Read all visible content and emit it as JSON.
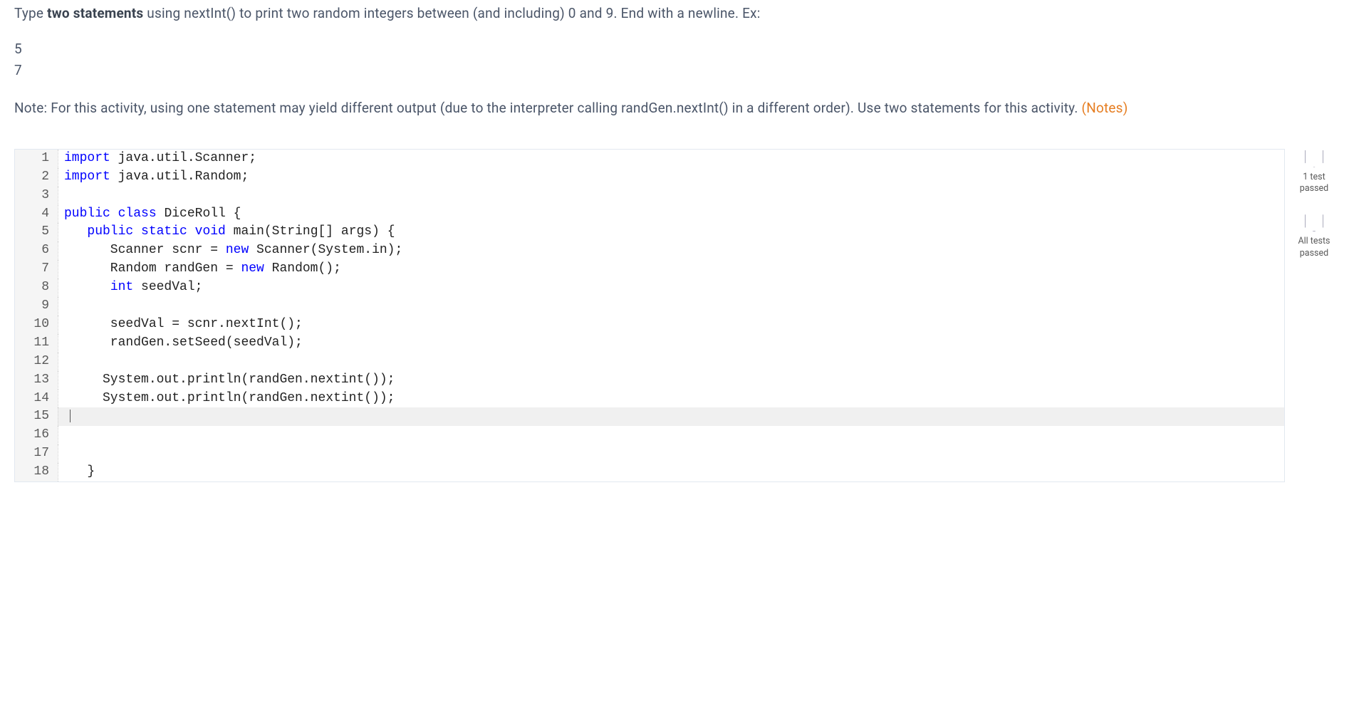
{
  "prompt": {
    "prefix": "Type ",
    "bold": "two statements",
    "suffix": " using nextInt() to print two random integers between (and including) 0 and 9. End with a newline. Ex:"
  },
  "example": {
    "line1": "5",
    "line2": "7"
  },
  "note": {
    "text": "Note: For this activity, using one statement may yield different output (due to the interpreter calling randGen.nextInt() in a different order). Use two statements for this activity. ",
    "link": "(Notes)"
  },
  "code": {
    "lines": [
      {
        "n": "1",
        "tokens": [
          {
            "t": "import",
            "c": "kw"
          },
          {
            "t": " java.util.Scanner;"
          }
        ]
      },
      {
        "n": "2",
        "tokens": [
          {
            "t": "import",
            "c": "kw"
          },
          {
            "t": " java.util.Random;"
          }
        ]
      },
      {
        "n": "3",
        "tokens": []
      },
      {
        "n": "4",
        "tokens": [
          {
            "t": "public",
            "c": "kw"
          },
          {
            "t": " "
          },
          {
            "t": "class",
            "c": "kw"
          },
          {
            "t": " DiceRoll {"
          }
        ]
      },
      {
        "n": "5",
        "tokens": [
          {
            "t": "   "
          },
          {
            "t": "public",
            "c": "kw"
          },
          {
            "t": " "
          },
          {
            "t": "static",
            "c": "kw"
          },
          {
            "t": " "
          },
          {
            "t": "void",
            "c": "kw"
          },
          {
            "t": " main(String[] args) {"
          }
        ]
      },
      {
        "n": "6",
        "tokens": [
          {
            "t": "      Scanner scnr = "
          },
          {
            "t": "new",
            "c": "kw"
          },
          {
            "t": " Scanner(System.in);"
          }
        ]
      },
      {
        "n": "7",
        "tokens": [
          {
            "t": "      Random randGen = "
          },
          {
            "t": "new",
            "c": "kw"
          },
          {
            "t": " Random();"
          }
        ]
      },
      {
        "n": "8",
        "tokens": [
          {
            "t": "      "
          },
          {
            "t": "int",
            "c": "kw"
          },
          {
            "t": " seedVal;"
          }
        ]
      },
      {
        "n": "9",
        "tokens": []
      },
      {
        "n": "10",
        "tokens": [
          {
            "t": "      seedVal = scnr.nextInt();"
          }
        ]
      },
      {
        "n": "11",
        "tokens": [
          {
            "t": "      randGen.setSeed(seedVal);"
          }
        ]
      },
      {
        "n": "12",
        "tokens": []
      },
      {
        "n": "13",
        "tokens": [
          {
            "t": "     System.out.println(randGen.nextint());"
          }
        ]
      },
      {
        "n": "14",
        "tokens": [
          {
            "t": "     System.out.println(randGen.nextint());"
          }
        ]
      },
      {
        "n": "15",
        "tokens": [],
        "current": true
      },
      {
        "n": "16",
        "tokens": []
      },
      {
        "n": "17",
        "tokens": []
      },
      {
        "n": "18",
        "tokens": [
          {
            "t": "   }"
          }
        ]
      }
    ]
  },
  "badges": {
    "test1": "1 test\npassed",
    "test2": "All tests\npassed"
  }
}
